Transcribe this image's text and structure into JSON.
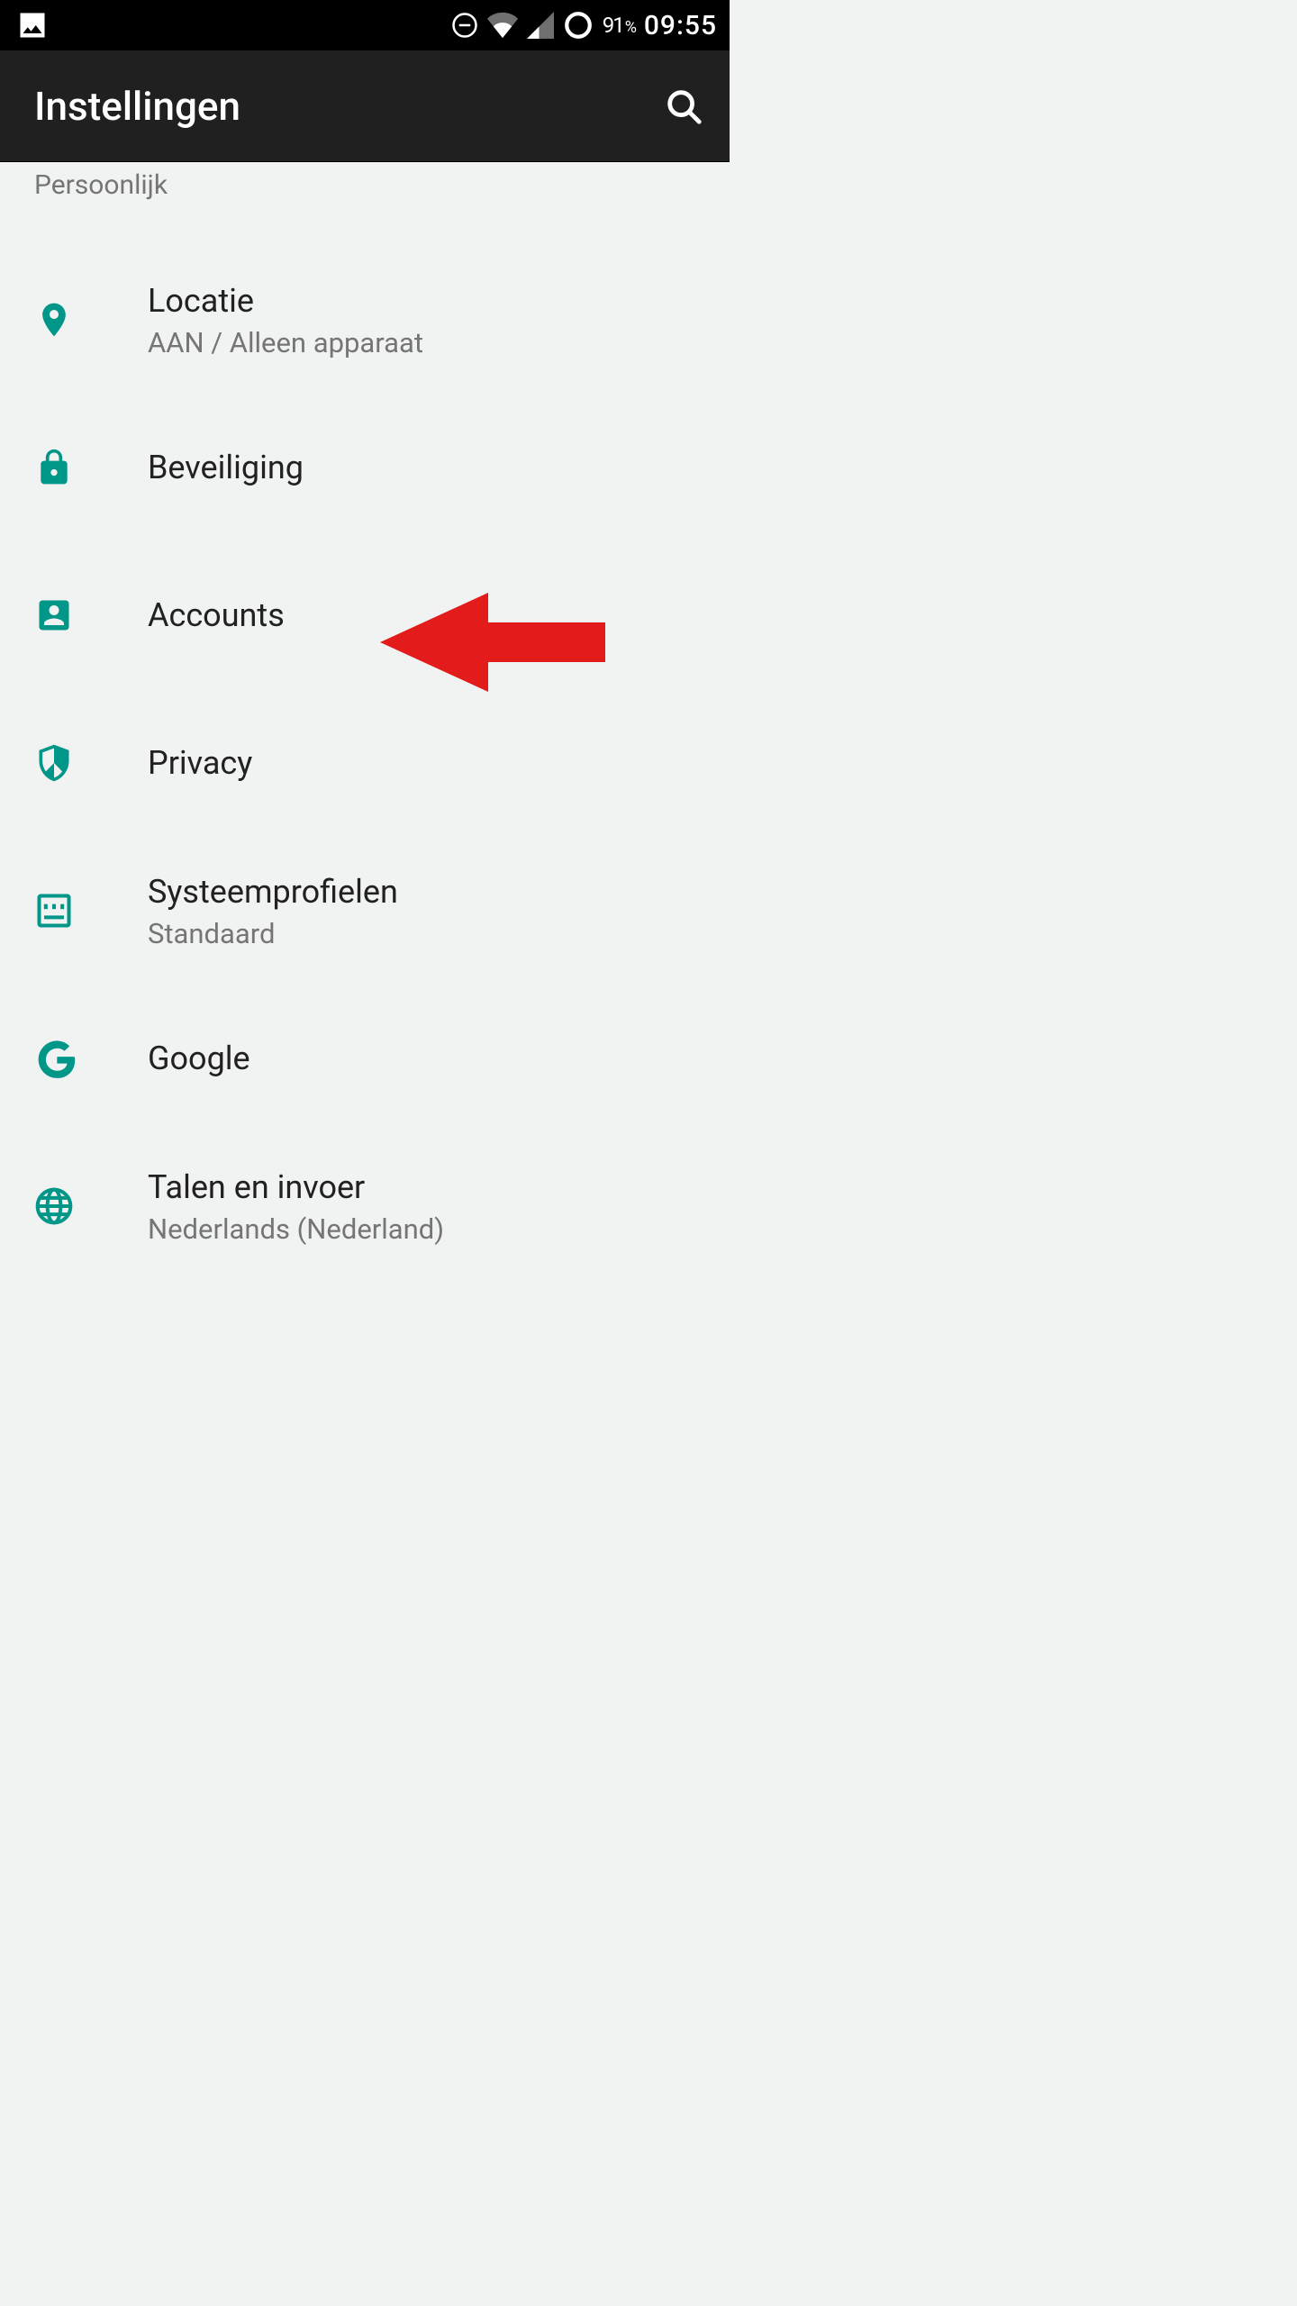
{
  "status_bar": {
    "battery_percent": "91",
    "percent_sign": "%",
    "time": "09:55"
  },
  "app_bar": {
    "title": "Instellingen"
  },
  "section": {
    "header": "Persoonlijk"
  },
  "items": [
    {
      "title": "Locatie",
      "sub": "AAN / Alleen apparaat"
    },
    {
      "title": "Beveiliging",
      "sub": ""
    },
    {
      "title": "Accounts",
      "sub": ""
    },
    {
      "title": "Privacy",
      "sub": ""
    },
    {
      "title": "Systeemprofielen",
      "sub": "Standaard"
    },
    {
      "title": "Google",
      "sub": ""
    },
    {
      "title": "Talen en invoer",
      "sub": "Nederlands (Nederland)"
    }
  ],
  "colors": {
    "accent": "#009688",
    "arrow": "#e31b1b"
  }
}
